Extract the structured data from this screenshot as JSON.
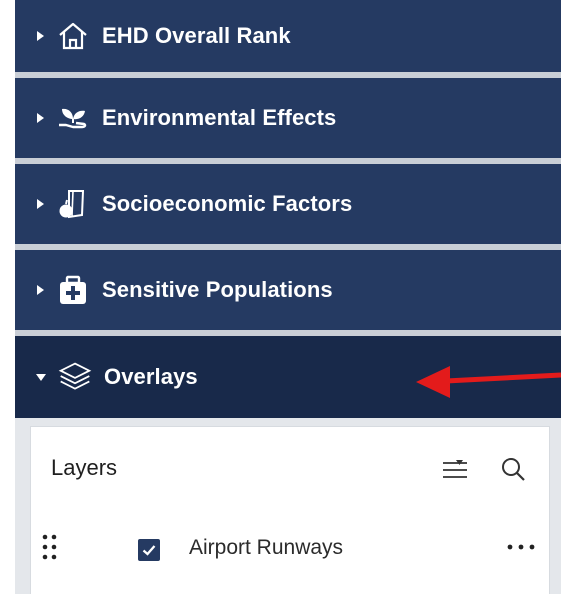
{
  "sections": [
    {
      "label": "EHD Overall Rank",
      "icon": "house-icon",
      "expanded": false
    },
    {
      "label": "Environmental Effects",
      "icon": "plant-in-hand-icon",
      "expanded": false
    },
    {
      "label": "Socioeconomic Factors",
      "icon": "apple-books-icon",
      "expanded": false
    },
    {
      "label": "Sensitive Populations",
      "icon": "first-aid-kit-icon",
      "expanded": false
    },
    {
      "label": "Overlays",
      "icon": "layers-icon",
      "expanded": true
    }
  ],
  "layers_panel": {
    "title": "Layers",
    "items": [
      {
        "label": "Airport Runways",
        "checked": true
      }
    ]
  },
  "colors": {
    "section_bg": "#253a62",
    "section_expanded_bg": "#18294a",
    "separator": "#c9ced6",
    "arrow": "#e31b1b",
    "checkbox": "#253a62"
  }
}
